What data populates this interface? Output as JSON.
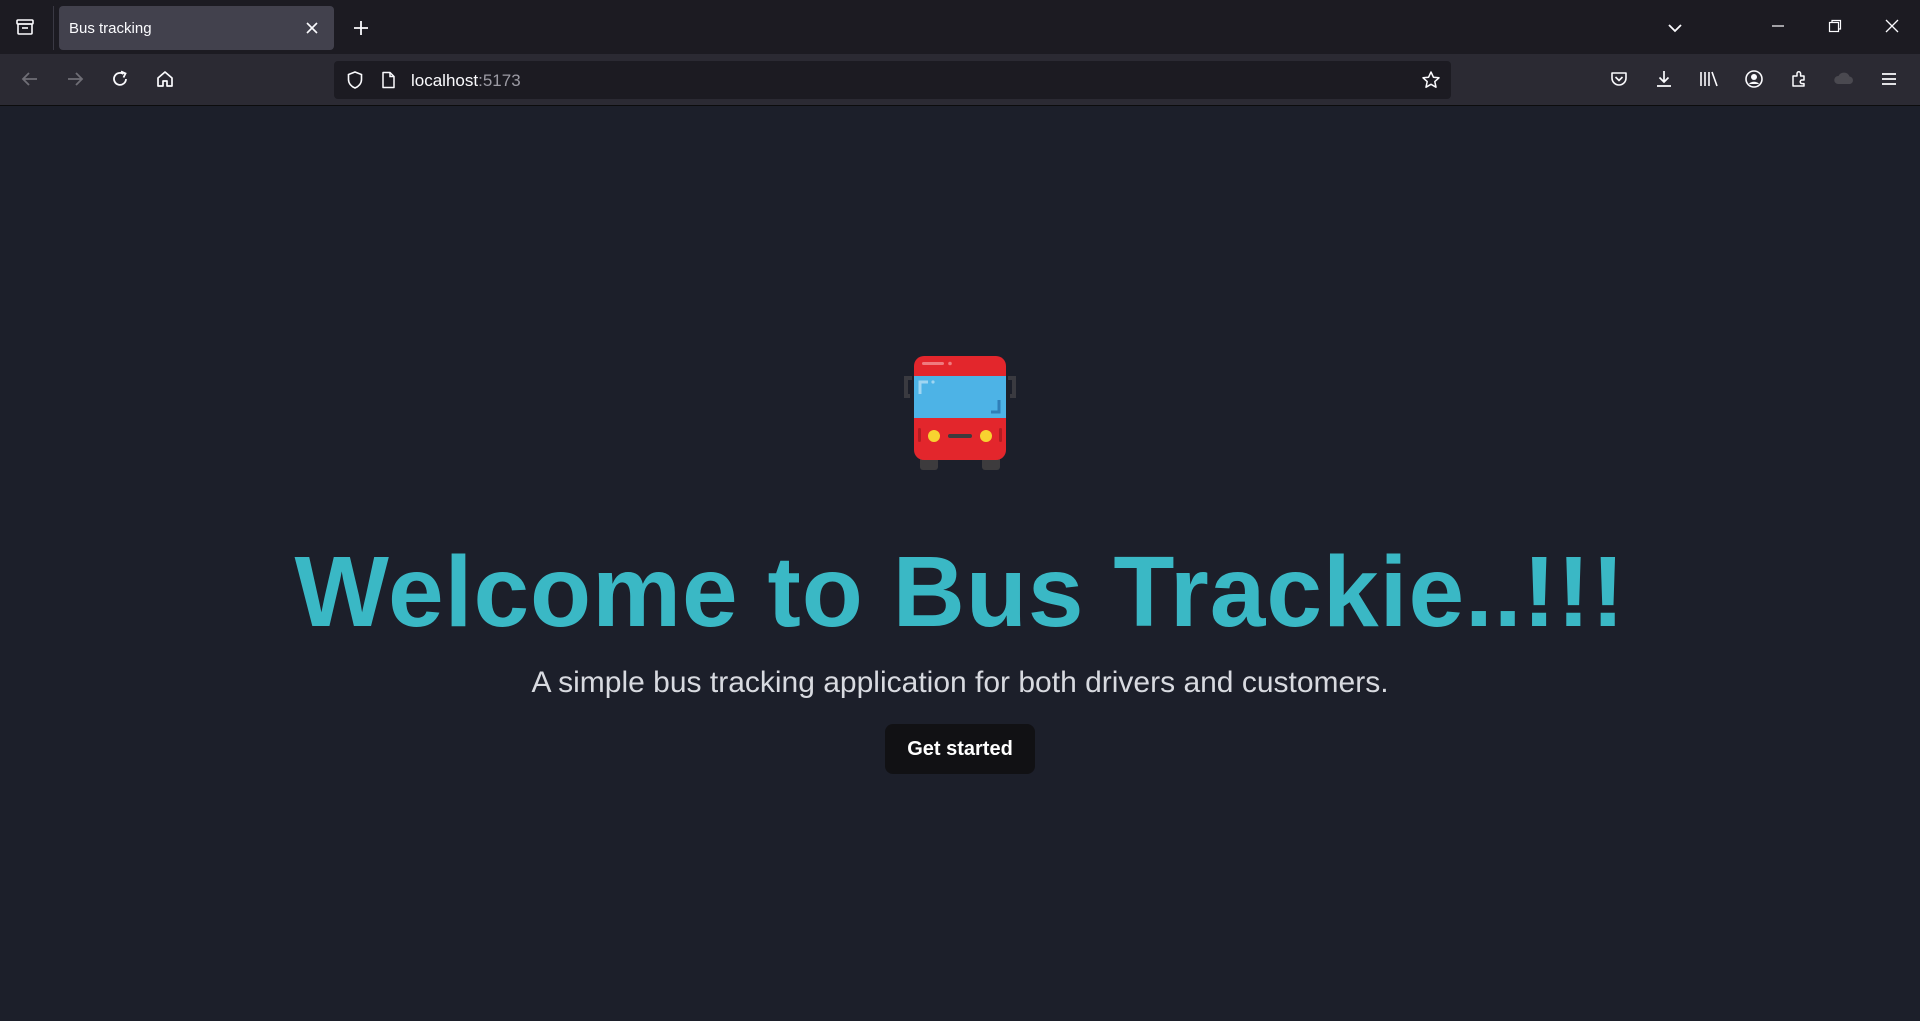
{
  "browser": {
    "tab": {
      "title": "Bus tracking"
    },
    "url": {
      "host": "localhost",
      "port": ":5173"
    }
  },
  "page": {
    "headline": "Welcome to Bus Trackie..!!!",
    "subtitle": "A simple bus tracking application for both drivers and customers.",
    "cta_label": "Get started"
  },
  "icons": {
    "hero": "bus-icon",
    "tab_bar": [
      "tab-list-icon",
      "close-icon",
      "plus-icon",
      "chevron-down-icon",
      "minimize-icon",
      "restore-icon",
      "close-window-icon"
    ],
    "toolbar": [
      "back-arrow-icon",
      "forward-arrow-icon",
      "reload-icon",
      "home-icon",
      "shield-icon",
      "page-icon",
      "star-icon",
      "pocket-icon",
      "download-icon",
      "library-icon",
      "account-icon",
      "extensions-icon",
      "sync-icon",
      "menu-icon"
    ]
  },
  "colors": {
    "page_background": "#1c1f2a",
    "headline": "#3ab8c5",
    "subtitle": "#d8dae0",
    "button_background": "#111114",
    "bus_red": "#e3262c",
    "bus_windshield": "#4db3e6",
    "bus_lights": "#f8d230"
  }
}
